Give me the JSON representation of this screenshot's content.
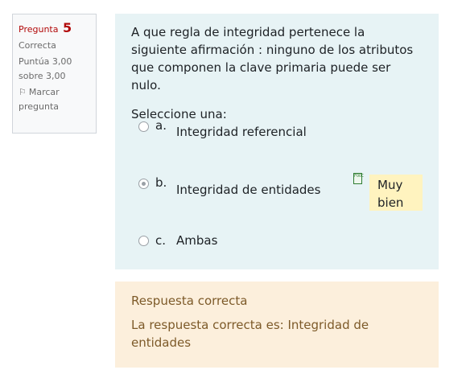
{
  "info": {
    "question_label": "Pregunta",
    "question_number": "5",
    "state": "Correcta",
    "grade_line1": "Puntúa 3,00",
    "grade_line2": "sobre 3,00",
    "flag_line1": "Marcar",
    "flag_line2": "pregunta"
  },
  "question": {
    "text": "A que regla de integridad pertenece la siguiente afirmación : ninguno de los atributos que componen la clave primaria puede ser nulo.",
    "prompt": "Seleccione una:",
    "answers": [
      {
        "letter": "a.",
        "text": "Integridad referencial",
        "checked": false
      },
      {
        "letter": "b.",
        "text": "Integridad de entidades",
        "checked": true
      },
      {
        "letter": "c.",
        "text": "Ambas",
        "checked": false
      }
    ],
    "feedback": "Muy bien",
    "mark_icon_text": "FOOC"
  },
  "outcome": {
    "correct_label": "Respuesta correcta",
    "right_answer": "La respuesta correcta es: Integridad de entidades"
  },
  "colors": {
    "content_bg": "#e7f3f5",
    "outcome_bg": "#fcefdc",
    "feedback_bg": "#fff3bf",
    "question_number": "#b20a0a"
  }
}
